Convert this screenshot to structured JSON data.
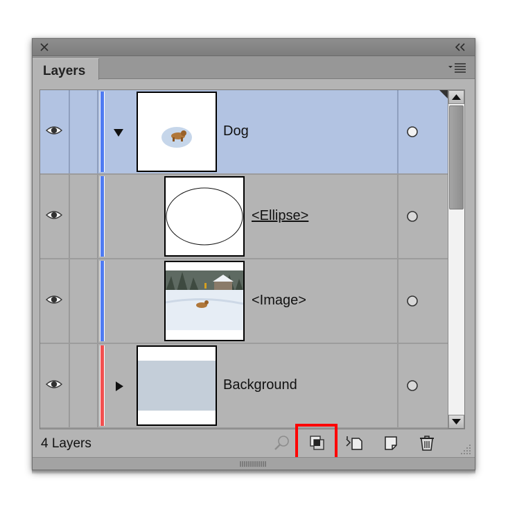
{
  "panel": {
    "tab_label": "Layers",
    "layer_count": "4 Layers"
  },
  "layers": [
    {
      "name": "Dog",
      "selected": true,
      "expanded": true,
      "color": "#4f7bf2"
    },
    {
      "name": "<Ellipse>",
      "selected": false,
      "sublayer": true,
      "color": "#4f7bf2"
    },
    {
      "name": "<Image>",
      "selected": false,
      "sublayer": true,
      "color": "#4f7bf2"
    },
    {
      "name": "Background",
      "selected": false,
      "expanded": false,
      "color": "#f25050"
    }
  ],
  "icons": {
    "close": "close-icon",
    "collapse": "double-chevron-icon",
    "menu": "panel-menu-icon",
    "visibility": "eye-icon",
    "target": "target-circle-icon",
    "locate": "locate-object-icon",
    "clipping": "make-clipping-mask-icon",
    "new_sublayer": "create-sublayer-icon",
    "new_layer": "create-layer-icon",
    "delete": "trash-icon"
  },
  "colors": {
    "selection": "#b2c3e2",
    "highlight_box": "#ff0000"
  }
}
